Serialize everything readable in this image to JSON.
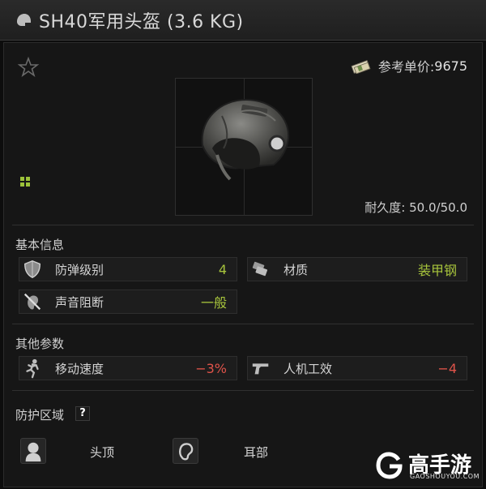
{
  "window": {
    "title": "SH40军用头盔 (3.6 KG)",
    "helmet_icon": "helmet-icon"
  },
  "header": {
    "favorite_icon": "star-outline-icon",
    "price_label": "参考单价:",
    "price_value": "9675",
    "price_icon": "money-bundle-icon"
  },
  "item": {
    "image": "helmet-image",
    "durability_label": "耐久度:",
    "durability_value": "50.0/50.0"
  },
  "basic_info": {
    "title": "基本信息",
    "stats": [
      {
        "label": "防弹级别",
        "value": "4",
        "icon": "shield-icon",
        "color": "#a7c43c"
      },
      {
        "label": "材质",
        "value": "装甲钢",
        "icon": "armor-plates-icon",
        "color": "#a7c43c"
      },
      {
        "label": "声音阻断",
        "value": "一般",
        "icon": "ear-muted-icon",
        "color": "#a7c43c"
      }
    ]
  },
  "other_params": {
    "title": "其他参数",
    "stats": [
      {
        "label": "移动速度",
        "value": "−3%",
        "icon": "running-man-icon",
        "color": "#e0534a"
      },
      {
        "label": "人机工效",
        "value": "−4",
        "icon": "pistol-icon",
        "color": "#e0534a"
      }
    ]
  },
  "protection": {
    "title": "防护区域",
    "help_label": "?",
    "zones": [
      {
        "label": "头顶",
        "icon": "head-icon"
      },
      {
        "label": "耳部",
        "icon": "ear-icon"
      }
    ]
  },
  "watermark": {
    "text": "高手游",
    "sub": "GAOSHOUYOU.COM"
  }
}
